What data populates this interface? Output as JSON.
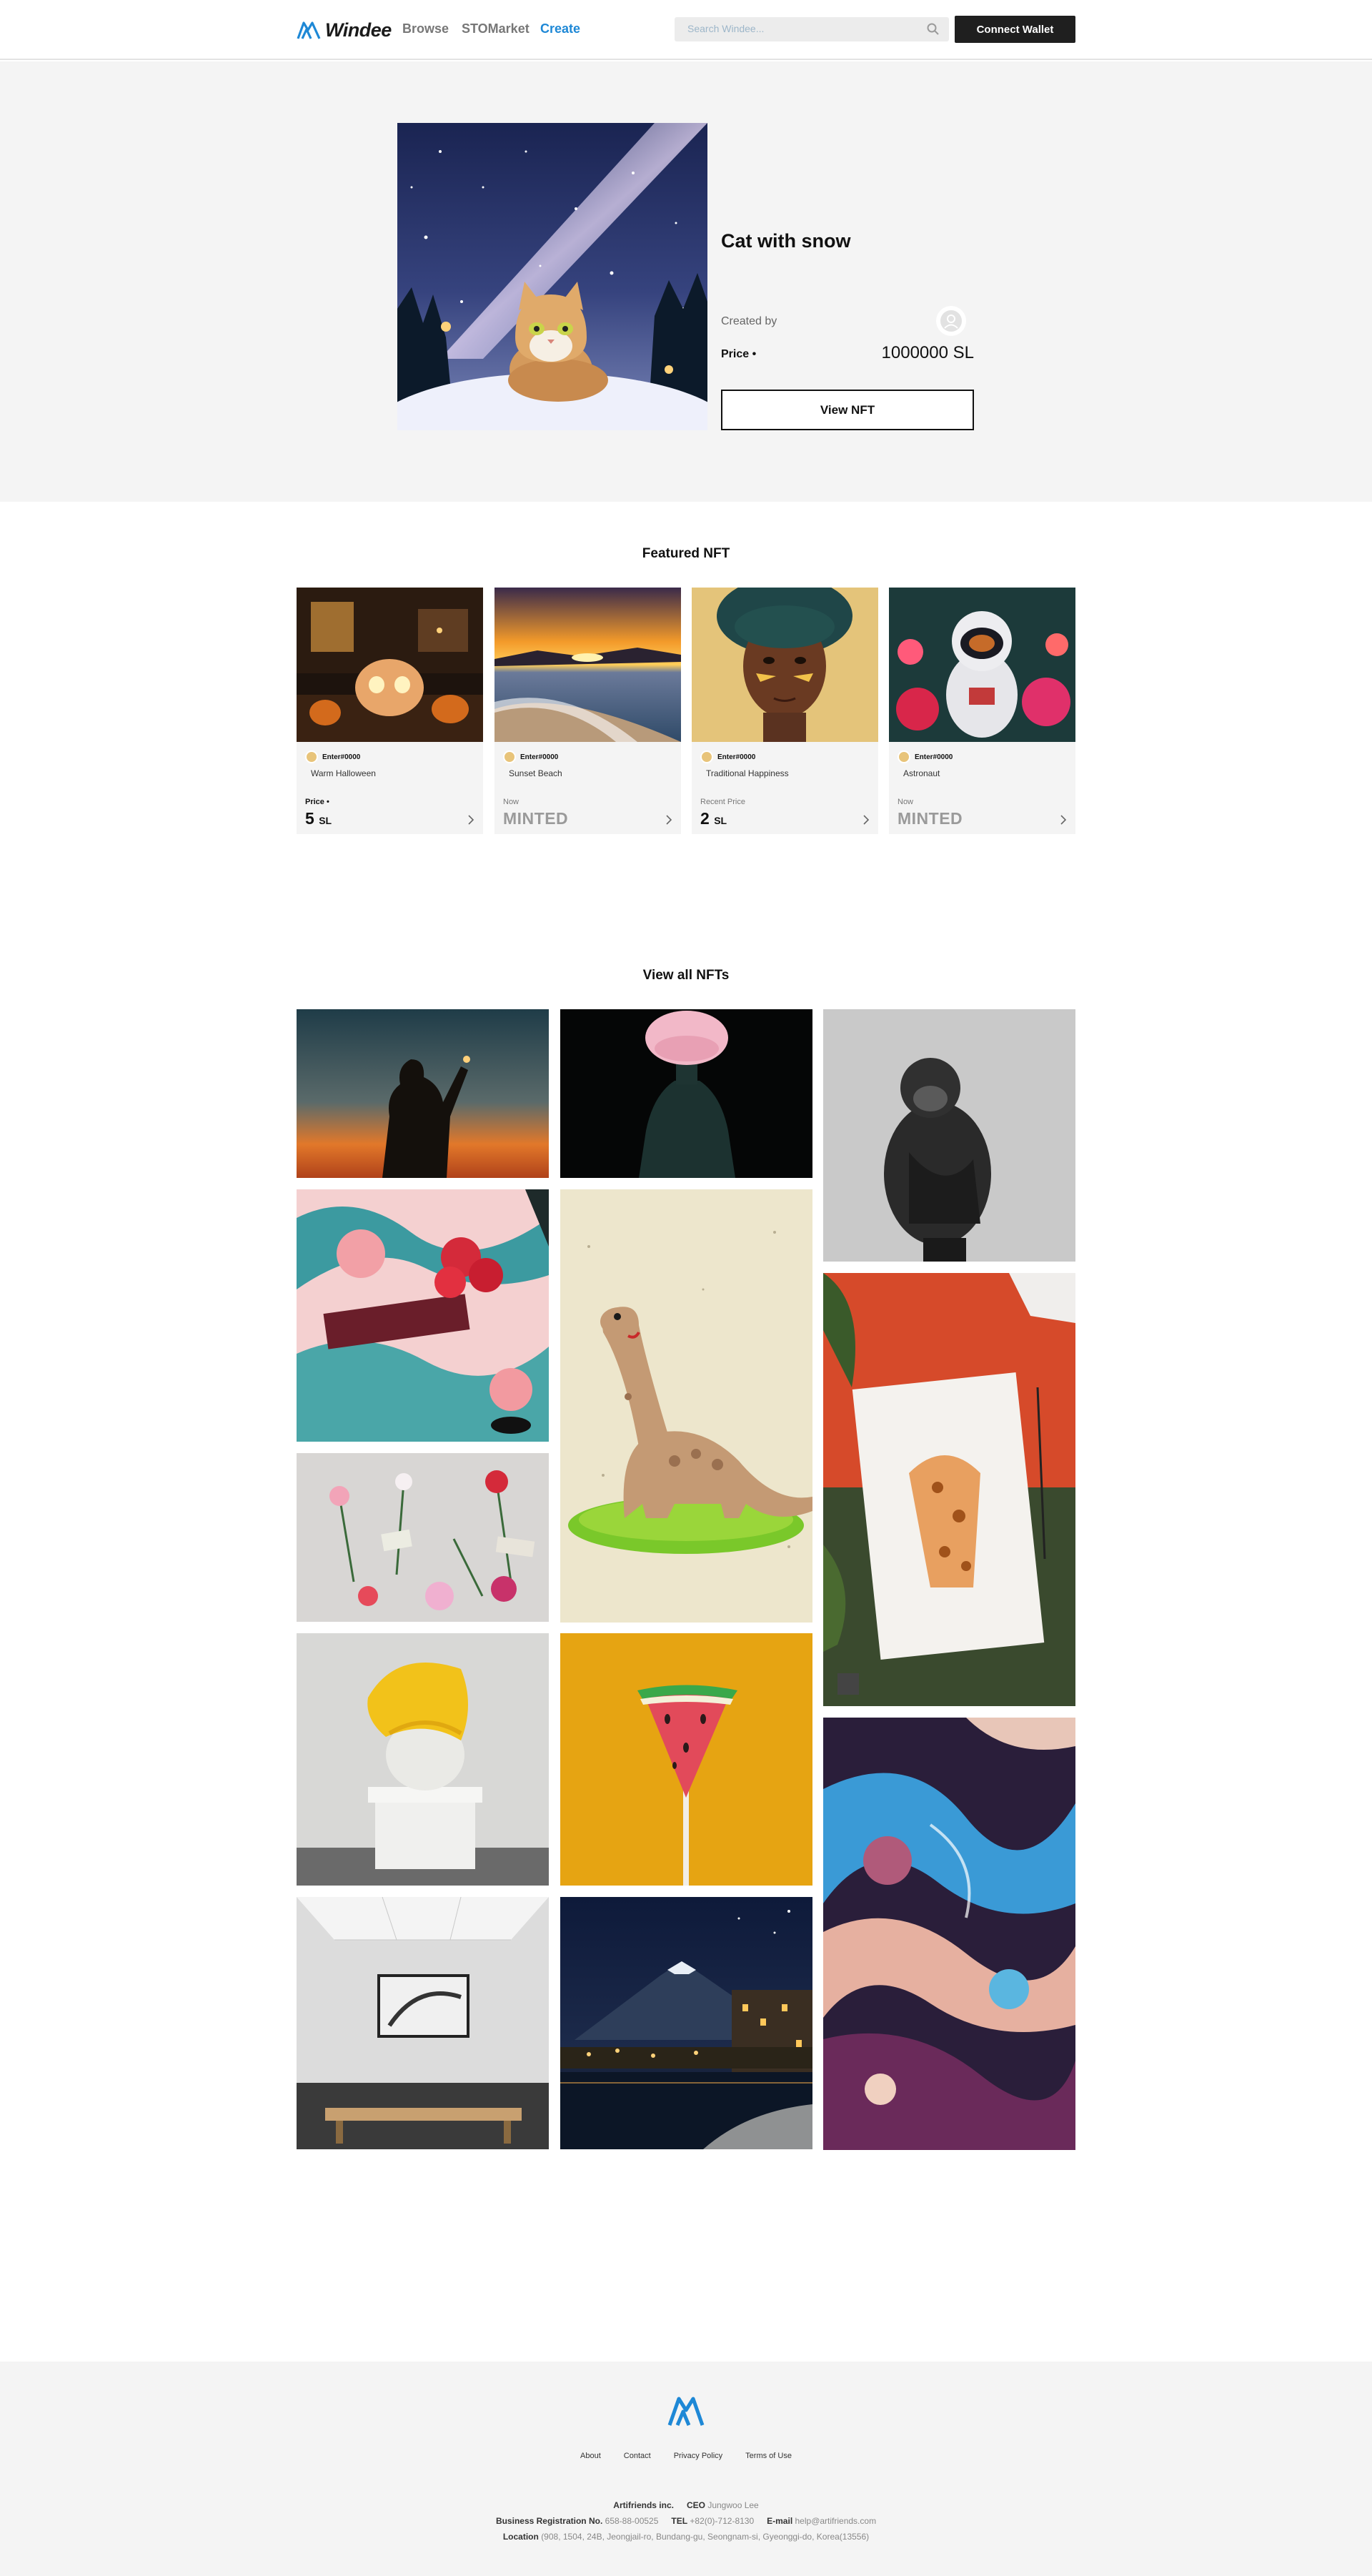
{
  "header": {
    "logo_text": "Windee",
    "nav": [
      {
        "label": "Browse"
      },
      {
        "label": "STOMarket"
      },
      {
        "label": "Create"
      }
    ],
    "search_placeholder": "Search Windee...",
    "connect_wallet_label": "Connect Wallet",
    "accent_color": "#1e88d6"
  },
  "hero": {
    "title": "Cat with snow",
    "created_by_label": "Created by",
    "price_label": "Price •",
    "price_value": "1000000 SL",
    "view_button_label": "View NFT"
  },
  "featured": {
    "title": "Featured NFT",
    "cards": [
      {
        "owner": "Enter#0000",
        "name": "Warm Halloween",
        "price_label": "Price •",
        "price_amount": "5",
        "price_unit": "SL",
        "status": ""
      },
      {
        "owner": "Enter#0000",
        "name": "Sunset Beach",
        "price_label": "Now",
        "price_amount": "",
        "price_unit": "",
        "status": "MINTED"
      },
      {
        "owner": "Enter#0000",
        "name": "Traditional Happiness",
        "price_label": "Recent Price",
        "price_amount": "2",
        "price_unit": "SL",
        "status": ""
      },
      {
        "owner": "Enter#0000",
        "name": "Astronaut",
        "price_label": "Now",
        "price_amount": "",
        "price_unit": "",
        "status": "MINTED"
      }
    ]
  },
  "gallery": {
    "title": "View all NFTs"
  },
  "footer": {
    "links": [
      "About",
      "Contact",
      "Privacy Policy",
      "Terms of Use"
    ],
    "company": "Artifriends inc.",
    "ceo_label": "CEO",
    "ceo": "Jungwoo Lee",
    "brn_label": "Business Registration No.",
    "brn": "658-88-00525",
    "tel_label": "TEL",
    "tel": "+82(0)-712-8130",
    "email_label": "E-mail",
    "email": "help@artifriends.com",
    "location_label": "Location",
    "location": "(908, 1504, 24B, Jeongjail-ro, Bundang-gu, Seongnam-si, Gyeonggi-do, Korea(13556)"
  }
}
